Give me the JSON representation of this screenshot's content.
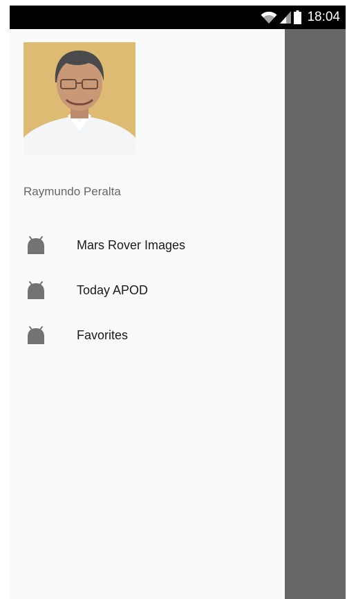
{
  "status_bar": {
    "time": "18:04",
    "icons": [
      "wifi-icon",
      "signal-icon",
      "battery-icon"
    ]
  },
  "drawer": {
    "user_name": "Raymundo Peralta",
    "items": [
      {
        "label": "Mars Rover Images",
        "icon": "android-icon"
      },
      {
        "label": "Today APOD",
        "icon": "android-icon"
      },
      {
        "label": "Favorites",
        "icon": "android-icon"
      }
    ]
  },
  "colors": {
    "status_bar": "#000000",
    "toolbar": "#1a1f4a",
    "scrim": "#666666",
    "drawer_background": "#fafafa",
    "icon": "#737373"
  }
}
